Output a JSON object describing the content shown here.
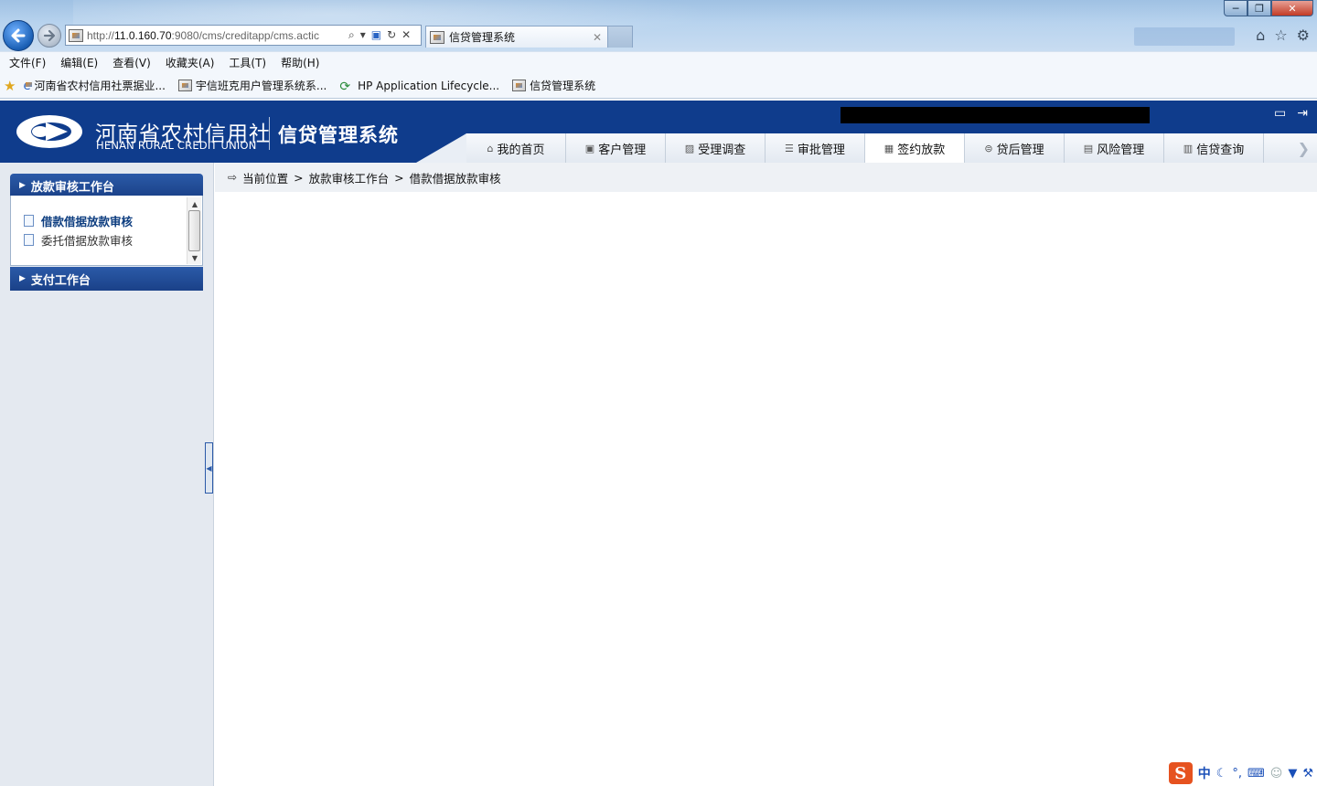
{
  "browser": {
    "url_prefix": "http://",
    "url_host": "11.0.160.70",
    "url_rest": ":9080/cms/creditapp/cms.actic",
    "tab_title": "信贷管理系统",
    "menu": [
      "文件(F)",
      "编辑(E)",
      "查看(V)",
      "收藏夹(A)",
      "工具(T)",
      "帮助(H)"
    ],
    "favorites": [
      "河南省农村信用社票据业...",
      "宇信班克用户管理系统系...",
      "HP Application Lifecycle...",
      "信贷管理系统"
    ],
    "icons": [
      "back-arrow-icon",
      "forward-arrow-icon",
      "search-icon",
      "refresh-icon",
      "stop-icon",
      "home-icon",
      "favorites-star-icon",
      "settings-gear-icon"
    ]
  },
  "header": {
    "org_name_cn": "河南省农村信用社",
    "org_name_en": "HENAN RURAL CREDIT UNION",
    "system_name": "信贷管理系统",
    "colors": {
      "header_bg": "#0f3c8c",
      "accent": "#2b5aa8"
    }
  },
  "nav": {
    "items": [
      {
        "label": "我的首页",
        "icon": "home-icon"
      },
      {
        "label": "客户管理",
        "icon": "customer-icon"
      },
      {
        "label": "受理调查",
        "icon": "survey-icon"
      },
      {
        "label": "审批管理",
        "icon": "list-icon"
      },
      {
        "label": "签约放款",
        "icon": "contract-icon"
      },
      {
        "label": "贷后管理",
        "icon": "post-loan-icon"
      },
      {
        "label": "风险管理",
        "icon": "risk-icon"
      },
      {
        "label": "信贷查询",
        "icon": "query-icon"
      }
    ],
    "active_index": 4
  },
  "sidebar": {
    "sections": [
      {
        "title": "放款审核工作台",
        "items": [
          "借款借据放款审核",
          "委托借据放款审核"
        ],
        "active_item": 0,
        "expanded": true
      },
      {
        "title": "支付工作台",
        "items": [],
        "expanded": false
      }
    ]
  },
  "breadcrumb": {
    "prefix": "当前位置",
    "path": [
      "放款审核工作台",
      "借款借据放款审核"
    ],
    "separator": ">"
  },
  "ime": {
    "brand": "S",
    "mode": "中"
  }
}
